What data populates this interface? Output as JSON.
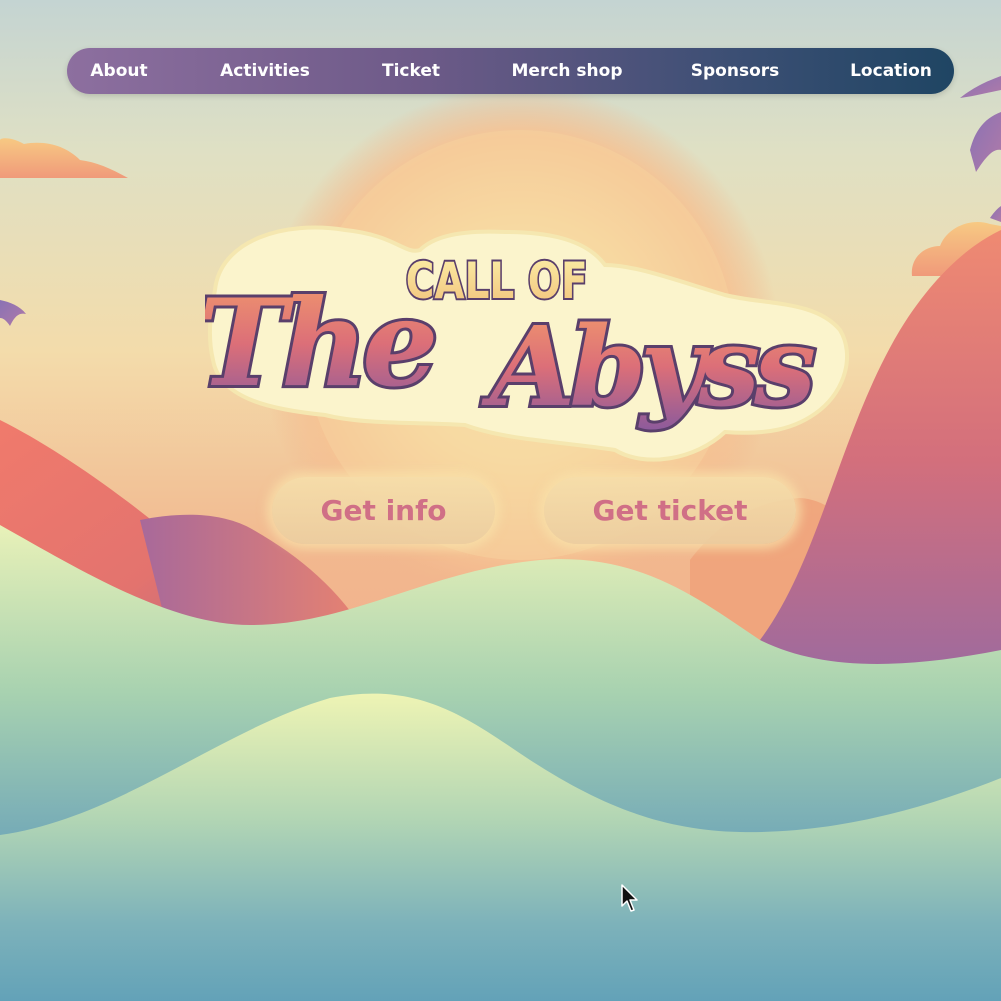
{
  "nav": {
    "items": [
      {
        "label": "About"
      },
      {
        "label": "Activities"
      },
      {
        "label": "Ticket"
      },
      {
        "label": "Merch shop"
      },
      {
        "label": "Sponsors"
      },
      {
        "label": "Location"
      }
    ]
  },
  "hero": {
    "logo": {
      "line1": "CALL OF",
      "line2a": "The",
      "line2b": "Abyss"
    },
    "buttons": {
      "info_label": "Get info",
      "ticket_label": "Get ticket"
    }
  },
  "colors": {
    "button_text": "#d06f86",
    "logo_outline": "#5a3f6b",
    "logo_sticker": "#fbf4cc",
    "nav_start": "#8d6f9f",
    "nav_end": "#1f4563"
  }
}
